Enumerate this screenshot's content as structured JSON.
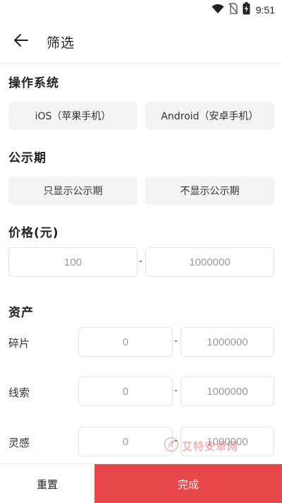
{
  "status_bar": {
    "time": "9:51",
    "icons": [
      "wifi-icon",
      "no-sim-icon",
      "battery-charging-icon"
    ]
  },
  "header": {
    "back_icon": "arrow-left-icon",
    "title": "筛选"
  },
  "os_section": {
    "title": "操作系统",
    "options": [
      {
        "label": "iOS（苹果手机）"
      },
      {
        "label": "Android（安卓手机）"
      }
    ]
  },
  "publicity_section": {
    "title": "公示期",
    "options": [
      {
        "label": "只显示公示期"
      },
      {
        "label": "不显示公示期"
      }
    ]
  },
  "price_section": {
    "title": "价格(元)",
    "min_placeholder": "100",
    "max_placeholder": "1000000",
    "separator": "-"
  },
  "assets_section": {
    "title": "资产",
    "rows": [
      {
        "label": "碎片",
        "min_placeholder": "0",
        "max_placeholder": "1000000",
        "separator": "-"
      },
      {
        "label": "线索",
        "min_placeholder": "0",
        "max_placeholder": "1000000",
        "separator": "-"
      },
      {
        "label": "灵感",
        "min_placeholder": "0",
        "max_placeholder": "1000000",
        "separator": "-"
      }
    ]
  },
  "watermark": {
    "text": "艾特安卓网"
  },
  "footer": {
    "reset_label": "重置",
    "done_label": "完成"
  },
  "colors": {
    "accent": "#e8474a",
    "chip_bg": "#f3f3f3",
    "border": "#e3e3e3"
  }
}
